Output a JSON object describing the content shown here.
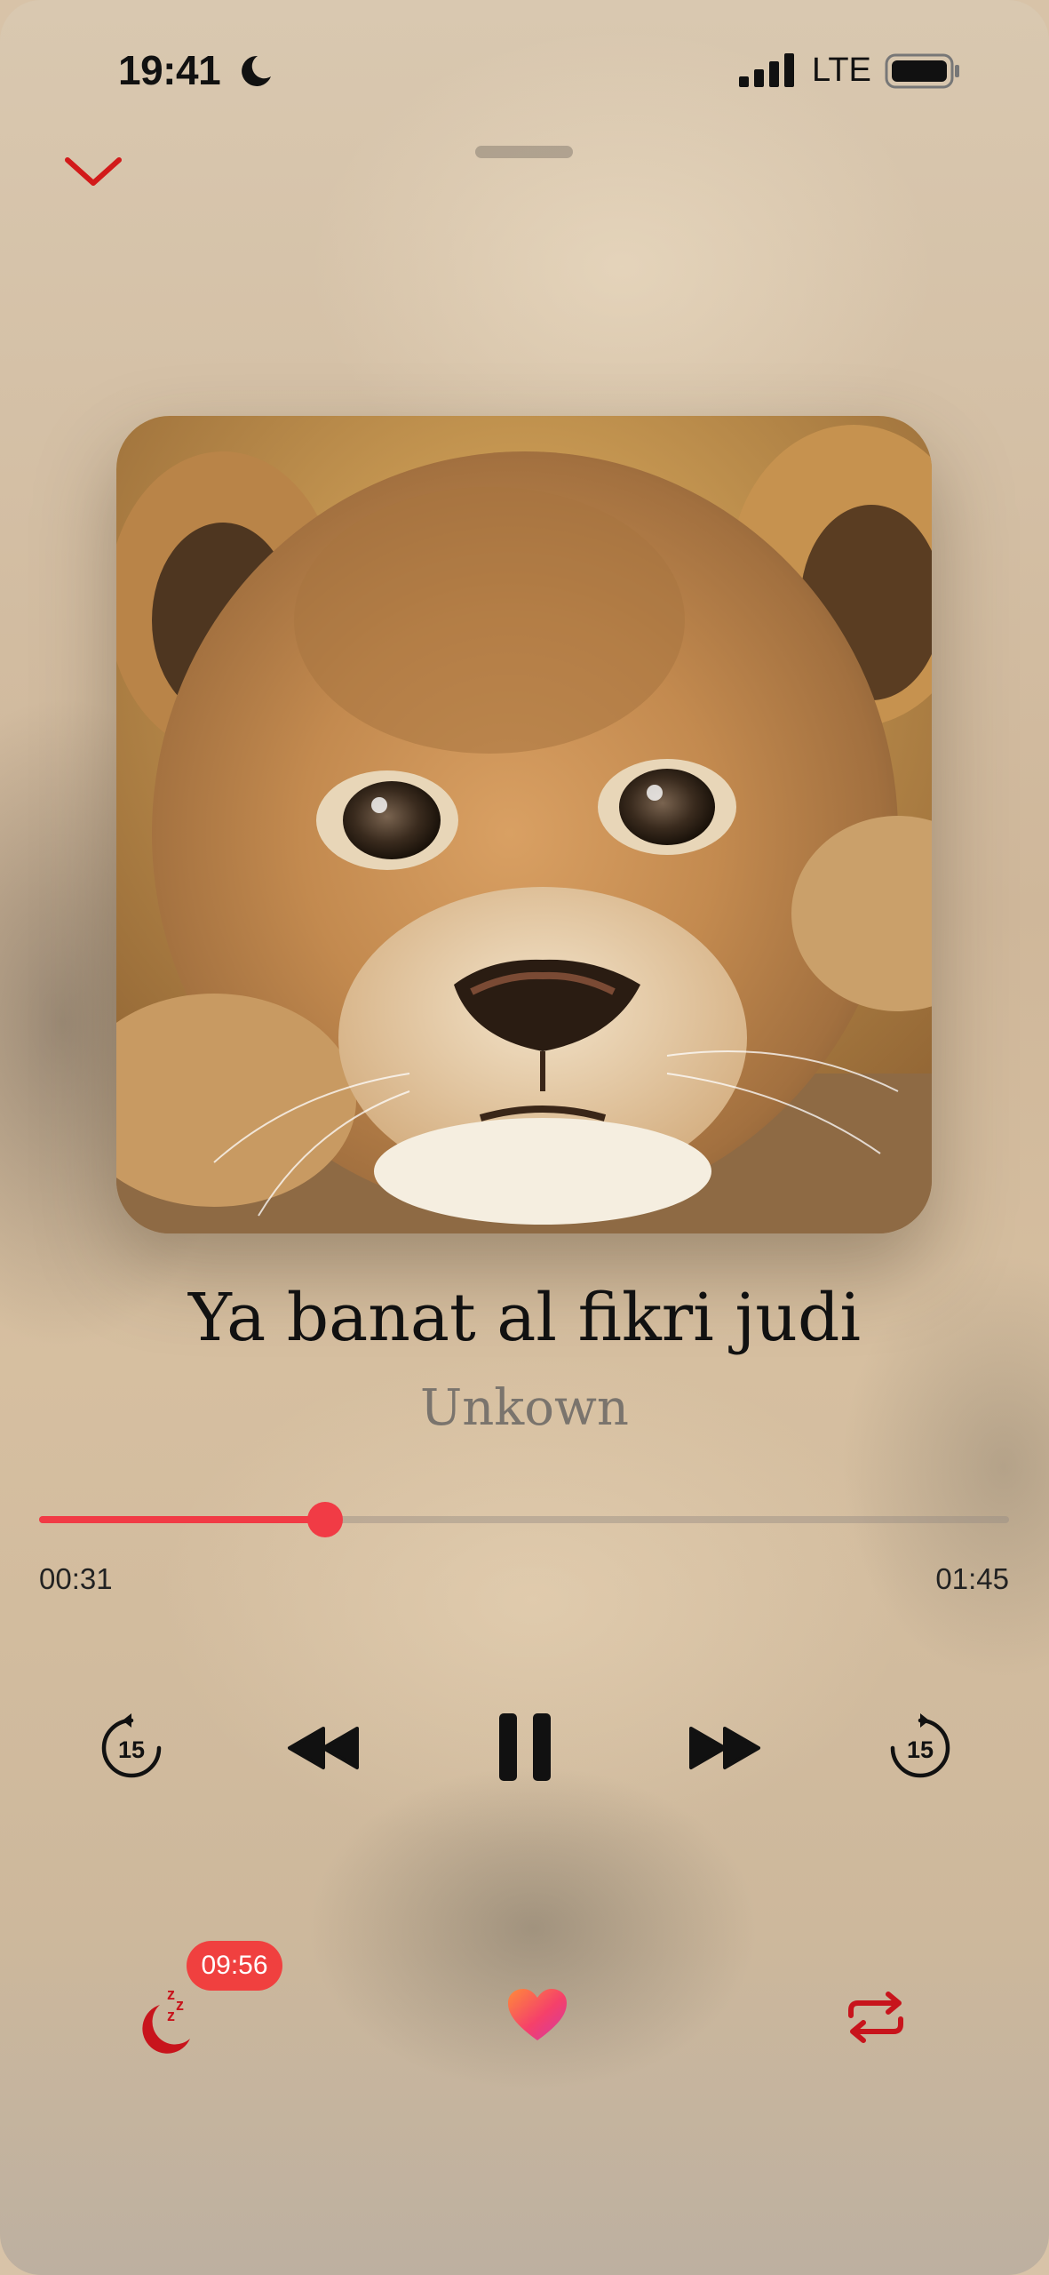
{
  "status_bar": {
    "time": "19:41",
    "network": "LTE",
    "icons": [
      "moon-icon",
      "signal-icon",
      "battery-icon"
    ]
  },
  "header": {
    "collapse_icon": "chevron-down-icon"
  },
  "track": {
    "title": "Ya banat al fikri judi",
    "artist": "Unkown",
    "artwork": "lion cub photo"
  },
  "progress": {
    "elapsed": "00:31",
    "total": "01:45",
    "fraction": 0.295
  },
  "controls": {
    "skip_back_seconds": "15",
    "skip_forward_seconds": "15",
    "icons": [
      "skip-back-15-icon",
      "rewind-icon",
      "pause-icon",
      "fast-forward-icon",
      "skip-forward-15-icon"
    ]
  },
  "bottom_bar": {
    "sleep_timer": "09:56",
    "icons": [
      "sleep-timer-icon",
      "heart-icon",
      "repeat-icon"
    ]
  },
  "colors": {
    "accent": "#f13b45",
    "icon_red": "#c8141c",
    "text": "#111111",
    "secondary_text": "#7a746d"
  }
}
